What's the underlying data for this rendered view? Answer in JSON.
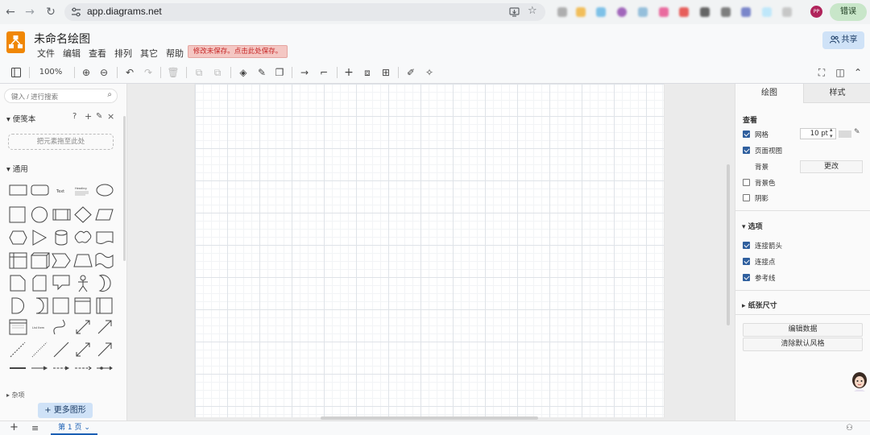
{
  "browser": {
    "url": "app.diagrams.net",
    "error_label": "错误",
    "avatar_text": "PP"
  },
  "app": {
    "title": "未命名绘图",
    "menu": [
      "文件",
      "编辑",
      "查看",
      "排列",
      "其它",
      "帮助"
    ],
    "unsaved_notice": "修改未保存。点击此处保存。",
    "share_label": "共享"
  },
  "toolbar": {
    "zoom": "100%"
  },
  "left_panel": {
    "search_placeholder": "键入 / 进行搜索",
    "scratchpad_title": "便笺本",
    "scratchpad_drop": "把元素拖至此处",
    "general_title": "通用",
    "misc_title": "杂项",
    "more_shapes": "更多图形",
    "shape_text_label": "Text",
    "shape_heading_label": "Heading",
    "shape_list_label": "List Item"
  },
  "right_panel": {
    "tabs": [
      "绘图",
      "样式"
    ],
    "view_title": "查看",
    "grid_label": "网格",
    "grid_size": "10 pt",
    "page_view_label": "页面视图",
    "background_label": "背景",
    "change_button": "更改",
    "bg_color_label": "背景色",
    "shadow_label": "阴影",
    "options_title": "选项",
    "connection_arrows_label": "连接箭头",
    "connection_points_label": "连接点",
    "guides_label": "参考线",
    "paper_size_title": "纸张尺寸",
    "edit_data_button": "编辑数据",
    "clear_style_button": "清除默认风格",
    "checks": {
      "grid": true,
      "page_view": true,
      "bg_color": false,
      "shadow": false,
      "arrows": true,
      "points": true,
      "guides": true
    }
  },
  "bottom": {
    "page_tab": "第 1 页"
  }
}
